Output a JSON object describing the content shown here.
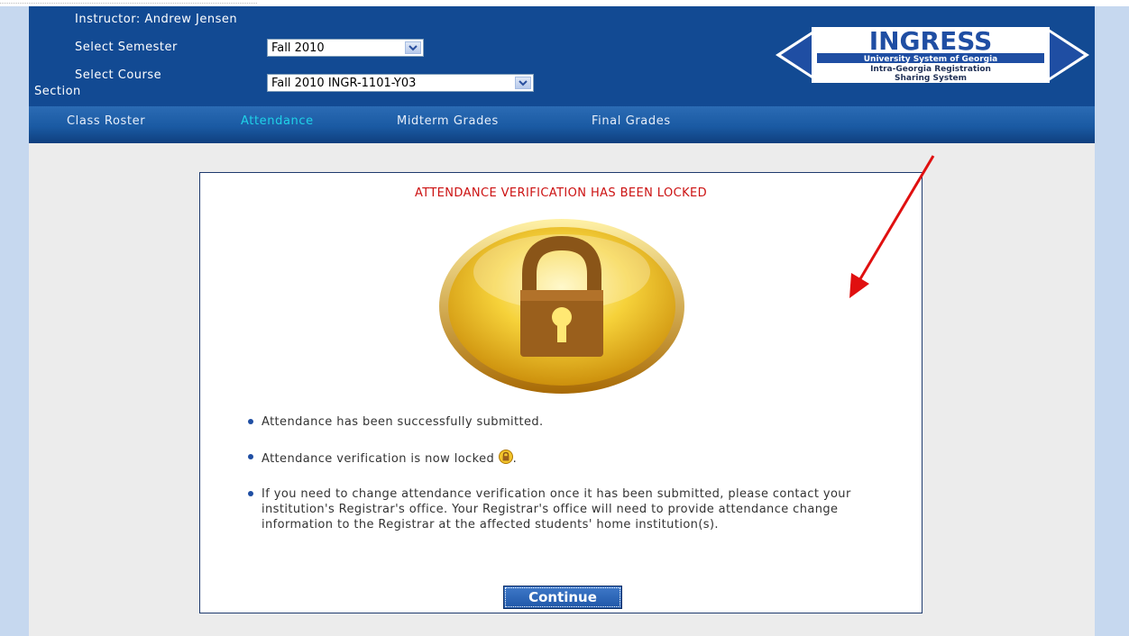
{
  "header": {
    "instructor_label": "Instructor: Andrew Jensen",
    "semester_label": "Select Semester",
    "semester_value": "Fall 2010",
    "course_label_line1": "Select Course",
    "course_label_line2": "Section",
    "course_value": "Fall 2010 INGR-1101-Y03"
  },
  "logo": {
    "name": "INGRESS",
    "line1": "University System of Georgia",
    "line2": "Intra-Georgia Registration",
    "line3": "Sharing System"
  },
  "nav": {
    "items": [
      {
        "label": "Class Roster",
        "active": false
      },
      {
        "label": "Attendance",
        "active": true
      },
      {
        "label": "Midterm Grades",
        "active": false
      },
      {
        "label": "Final Grades",
        "active": false
      }
    ]
  },
  "dialog": {
    "title": "ATTENDANCE VERIFICATION HAS BEEN LOCKED",
    "lock_icon": "padlock-icon",
    "bullets": [
      "Attendance has been successfully submitted.",
      "Attendance verification is now locked",
      "If you need to change attendance verification once it has been submitted, please contact your institution's Registrar's office. Your Registrar's office will need to provide attendance change information to the Registrar at the affected students' home institution(s)."
    ],
    "bullet2_suffix": ".",
    "continue_label": "Continue"
  },
  "colors": {
    "header_bg": "#124a93",
    "active_tab": "#1fd3e8",
    "title_red": "#cc1111",
    "annotation_arrow": "#e01010"
  }
}
